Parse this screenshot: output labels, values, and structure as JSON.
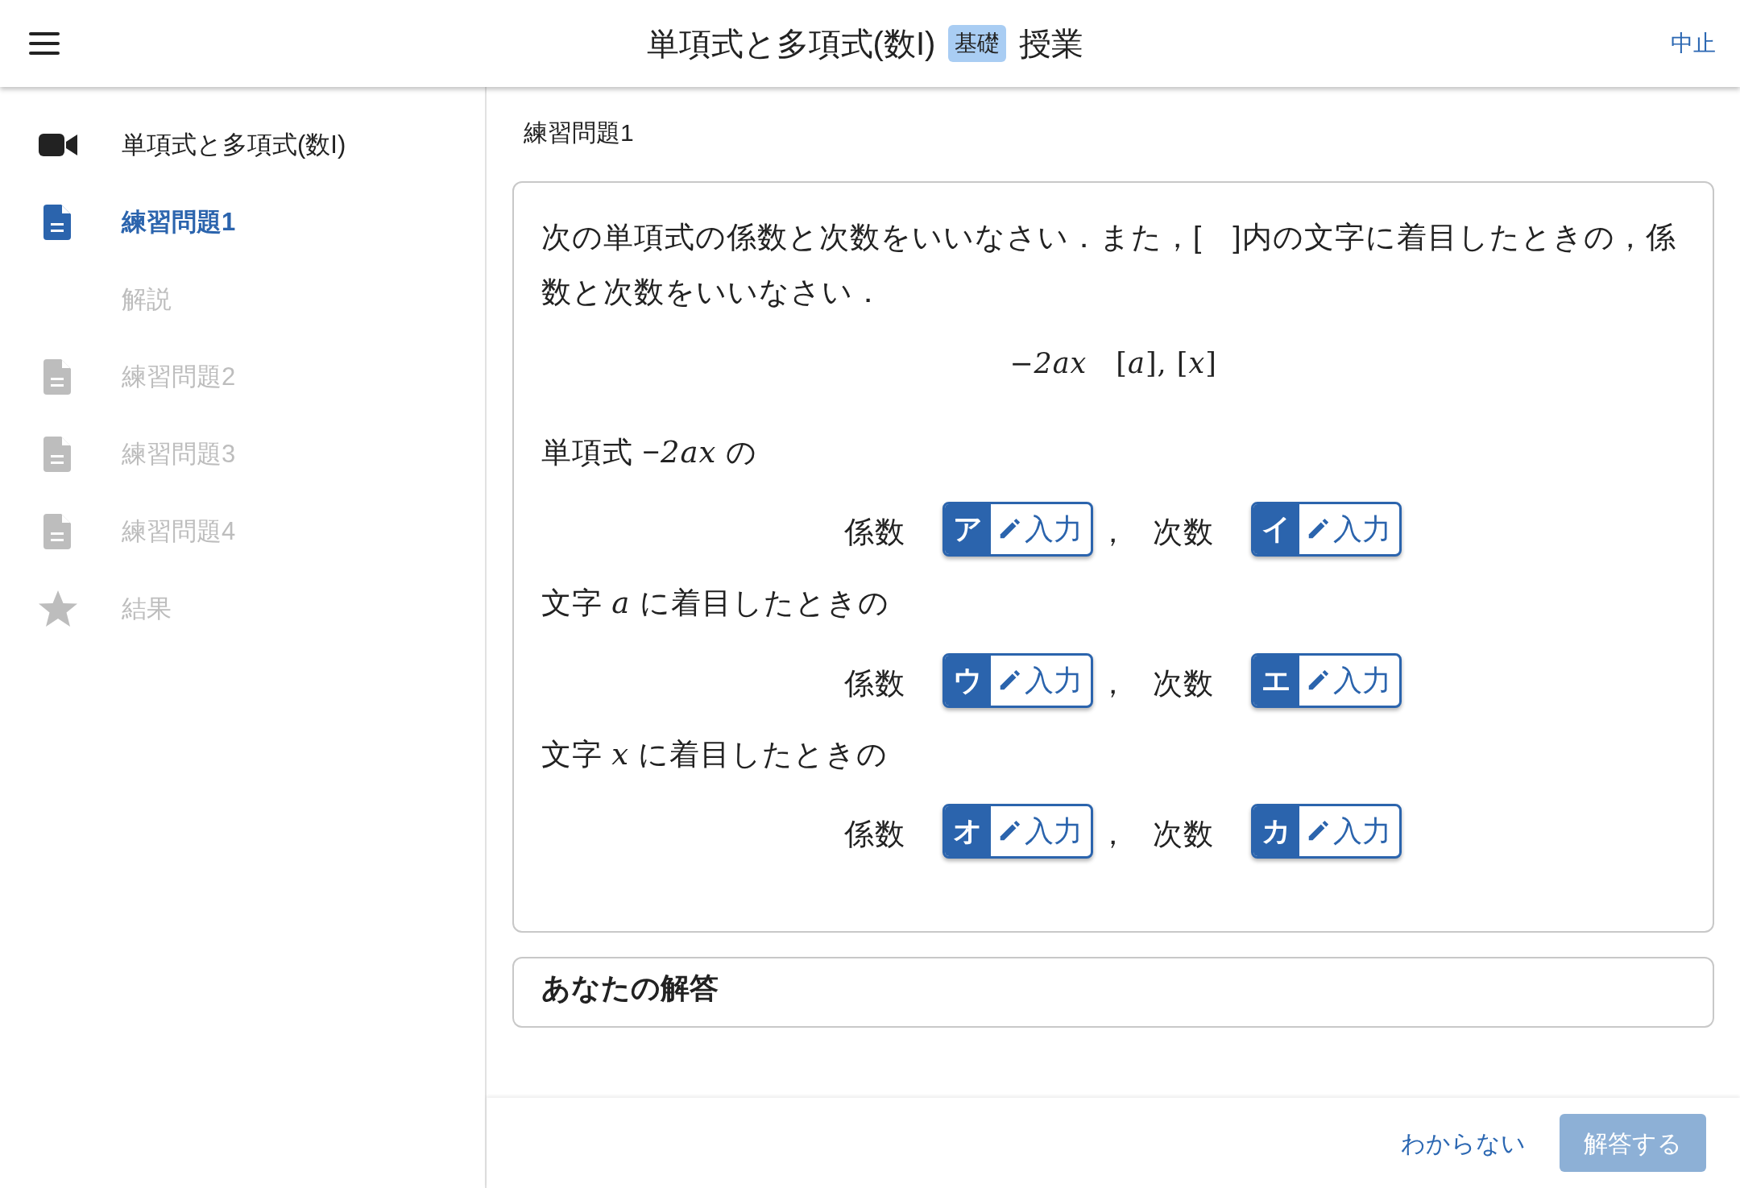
{
  "header": {
    "title": "単項式と多項式(数I)",
    "badge": "基礎",
    "subtitle": "授業",
    "action": "中止"
  },
  "sidebar": {
    "items": [
      {
        "kind": "video",
        "label": "単項式と多項式(数I)",
        "selected": false,
        "disabled": false
      },
      {
        "kind": "document",
        "label": "練習問題1",
        "selected": true,
        "disabled": false
      },
      {
        "kind": "sub",
        "label": "解説",
        "selected": false,
        "disabled": true
      },
      {
        "kind": "document",
        "label": "練習問題2",
        "selected": false,
        "disabled": true
      },
      {
        "kind": "document",
        "label": "練習問題3",
        "selected": false,
        "disabled": true
      },
      {
        "kind": "document",
        "label": "練習問題4",
        "selected": false,
        "disabled": true
      },
      {
        "kind": "star",
        "label": "結果",
        "selected": false,
        "disabled": true
      }
    ]
  },
  "main": {
    "title": "練習問題1",
    "question": {
      "instruction": "次の単項式の係数と次数をいいなさい．また，[　]内の文字に着目したときの，係数と次数をいいなさい．",
      "expression": "−*2ax*　[*a*], [*x*]",
      "parts": [
        {
          "heading": "単項式 −*2ax* の",
          "separator": "，",
          "fields": [
            {
              "label": "係数",
              "key": "ア",
              "placeholder": "入力"
            },
            {
              "label": "次数",
              "key": "イ",
              "placeholder": "入力"
            }
          ]
        },
        {
          "heading": "文字 *a* に着目したときの",
          "separator": "，",
          "fields": [
            {
              "label": "係数",
              "key": "ウ",
              "placeholder": "入力"
            },
            {
              "label": "次数",
              "key": "エ",
              "placeholder": "入力"
            }
          ]
        },
        {
          "heading": "文字 *x* に着目したときの",
          "separator": "，",
          "fields": [
            {
              "label": "係数",
              "key": "オ",
              "placeholder": "入力"
            },
            {
              "label": "次数",
              "key": "カ",
              "placeholder": "入力"
            }
          ]
        }
      ]
    },
    "answer_card": {
      "title": "あなたの解答"
    }
  },
  "footer": {
    "buttons": [
      {
        "kind": "link",
        "label": "わからない",
        "disabled": false
      },
      {
        "kind": "primary",
        "label": "解答する",
        "disabled": true
      }
    ]
  }
}
